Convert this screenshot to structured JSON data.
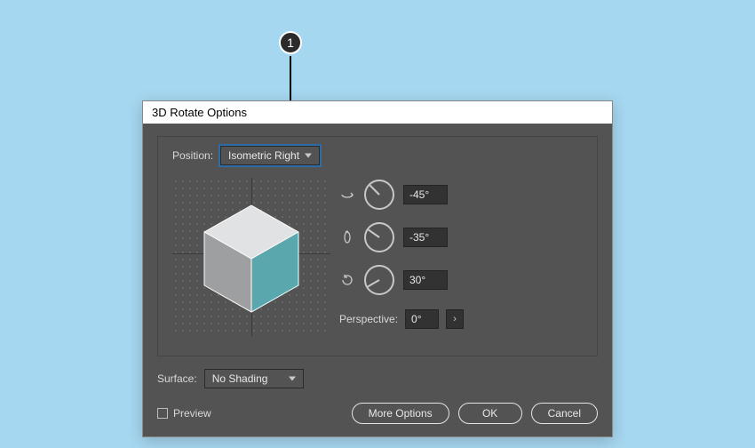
{
  "callout": {
    "number": "1"
  },
  "dialog": {
    "title": "3D Rotate Options",
    "position_label": "Position:",
    "position_value": "Isometric Right",
    "rotations": {
      "x": "-45°",
      "y": "-35°",
      "z": "30°"
    },
    "perspective_label": "Perspective:",
    "perspective_value": "0°",
    "surface_label": "Surface:",
    "surface_value": "No Shading",
    "preview_label": "Preview",
    "buttons": {
      "more": "More Options",
      "ok": "OK",
      "cancel": "Cancel"
    },
    "colors": {
      "cube_top": "#e1e2e3",
      "cube_left": "#9e9fa0",
      "cube_right": "#5aa7ae"
    }
  }
}
